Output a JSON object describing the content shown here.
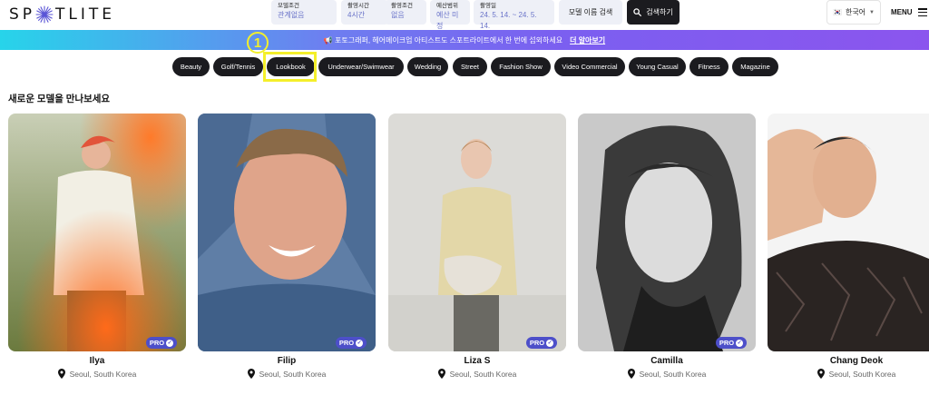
{
  "header": {
    "logo_text_left": "SP",
    "logo_text_right": "TLITE",
    "filters": [
      {
        "label": "모델조건",
        "value": "관계없음"
      },
      {
        "label": "촬영시간",
        "value": "4시간"
      },
      {
        "label": "촬영조건",
        "value": "없음"
      },
      {
        "label": "예산범위",
        "value": "예산 미정"
      },
      {
        "label": "촬영일",
        "value": "24. 5. 14. ~ 24. 5. 14."
      }
    ],
    "name_search_label": "모델 이름 검색",
    "search_button_label": "검색하기",
    "language_label": "한국어",
    "menu_label": "MENU"
  },
  "banner": {
    "message": "📢 포토그래퍼, 헤어메이크업 아티스트도 스포트라이트에서 한 번에 섭외하세요",
    "cta_label": "더 알아보기"
  },
  "annotation": {
    "number": "1",
    "color": "#f4ef2a"
  },
  "categories": [
    "Beauty",
    "Golf/Tennis",
    "Lookbook",
    "Underwear/Swimwear",
    "Wedding",
    "Street",
    "Fashion Show",
    "Video Commercial",
    "Young Casual",
    "Fitness",
    "Magazine"
  ],
  "selected_category": "Lookbook",
  "section_title": "새로운 모델을 만나보세요",
  "models": [
    {
      "name": "Ilya",
      "location": "Seoul, South Korea",
      "badge": "PRO"
    },
    {
      "name": "Filip",
      "location": "Seoul, South Korea",
      "badge": "PRO"
    },
    {
      "name": "Liza S",
      "location": "Seoul, South Korea",
      "badge": "PRO"
    },
    {
      "name": "Camilla",
      "location": "Seoul, South Korea",
      "badge": "PRO"
    },
    {
      "name": "Chang Deok",
      "location": "Seoul, South Korea",
      "badge": ""
    }
  ],
  "colors": {
    "accent": "#4d4fc9",
    "pill_bg": "#1b1b1f",
    "highlight": "#f4ef2a"
  }
}
